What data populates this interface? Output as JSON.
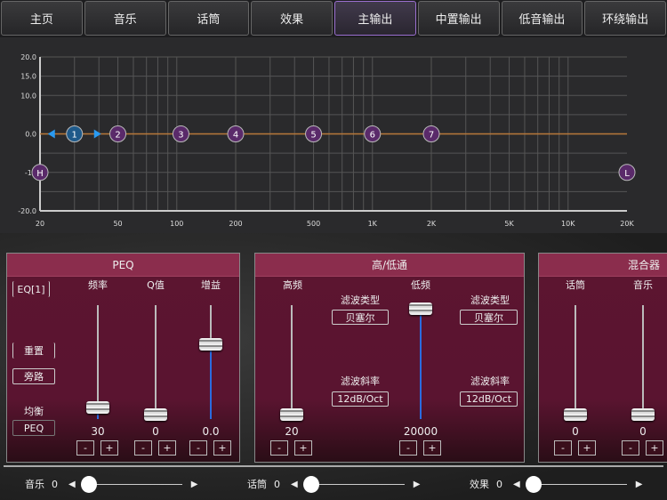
{
  "tabs": [
    {
      "label": "主页"
    },
    {
      "label": "音乐"
    },
    {
      "label": "话筒"
    },
    {
      "label": "效果"
    },
    {
      "label": "主输出",
      "active": true
    },
    {
      "label": "中置输出"
    },
    {
      "label": "低音输出"
    },
    {
      "label": "环绕输出"
    }
  ],
  "eq_chart": {
    "y_ticks": [
      "20.0",
      "15.0",
      "10.0",
      "0.0",
      "-10",
      "-20.0"
    ],
    "x_ticks": [
      {
        "f": 20,
        "label": "20"
      },
      {
        "f": 50,
        "label": "50"
      },
      {
        "f": 100,
        "label": "100"
      },
      {
        "f": 200,
        "label": "200"
      },
      {
        "f": 500,
        "label": "500"
      },
      {
        "f": 1000,
        "label": "1K"
      },
      {
        "f": 2000,
        "label": "2K"
      },
      {
        "f": 5000,
        "label": "5K"
      },
      {
        "f": 10000,
        "label": "10K"
      },
      {
        "f": 20000,
        "label": "20K"
      }
    ],
    "bands": [
      {
        "label": "1",
        "freq": 30,
        "gain": 0,
        "selected": true
      },
      {
        "label": "2",
        "freq": 50,
        "gain": 0
      },
      {
        "label": "3",
        "freq": 105,
        "gain": 0
      },
      {
        "label": "4",
        "freq": 200,
        "gain": 0
      },
      {
        "label": "5",
        "freq": 500,
        "gain": 0
      },
      {
        "label": "6",
        "freq": 1000,
        "gain": 0
      },
      {
        "label": "7",
        "freq": 2000,
        "gain": 0
      }
    ],
    "high_pass": {
      "label": "H",
      "freq": 20,
      "gain": -10
    },
    "low_pass": {
      "label": "L",
      "freq": 20000,
      "gain": -10
    },
    "colors": {
      "curve": "#b8783a",
      "node": "#5a2a6a",
      "selected": "#1f5a8a",
      "arrow": "#2a9af0"
    }
  },
  "peq": {
    "title": "PEQ",
    "eq_select": "EQ[1]",
    "reset": "重置",
    "bypass": "旁路",
    "balance_label": "均衡",
    "balance_mode": "PEQ",
    "sliders": [
      {
        "label": "频率",
        "value": "30",
        "level": 0.1,
        "fill": true
      },
      {
        "label": "Q值",
        "value": "0",
        "level": 0.04,
        "fill": false
      },
      {
        "label": "增益",
        "value": "0.0",
        "level": 0.66,
        "fill": true
      }
    ]
  },
  "hl": {
    "title": "高/低通",
    "high_label": "高频",
    "high_value": "20",
    "high_level": 0.04,
    "low_label": "低频",
    "low_value": "20000",
    "low_level": 1,
    "filter_type_label": "滤波类型",
    "filter_type_left": "贝塞尔",
    "filter_type_right": "贝塞尔",
    "slope_label": "滤波斜率",
    "slope_left": "12dB/Oct",
    "slope_right": "12dB/Oct"
  },
  "mixer": {
    "title": "混合器",
    "channels": [
      {
        "label": "话筒",
        "value": "0"
      },
      {
        "label": "音乐",
        "value": "0"
      }
    ]
  },
  "bottom": [
    {
      "label": "音乐",
      "value": "0"
    },
    {
      "label": "话筒",
      "value": "0"
    },
    {
      "label": "效果",
      "value": "0"
    }
  ],
  "minus": "-",
  "plus": "+"
}
